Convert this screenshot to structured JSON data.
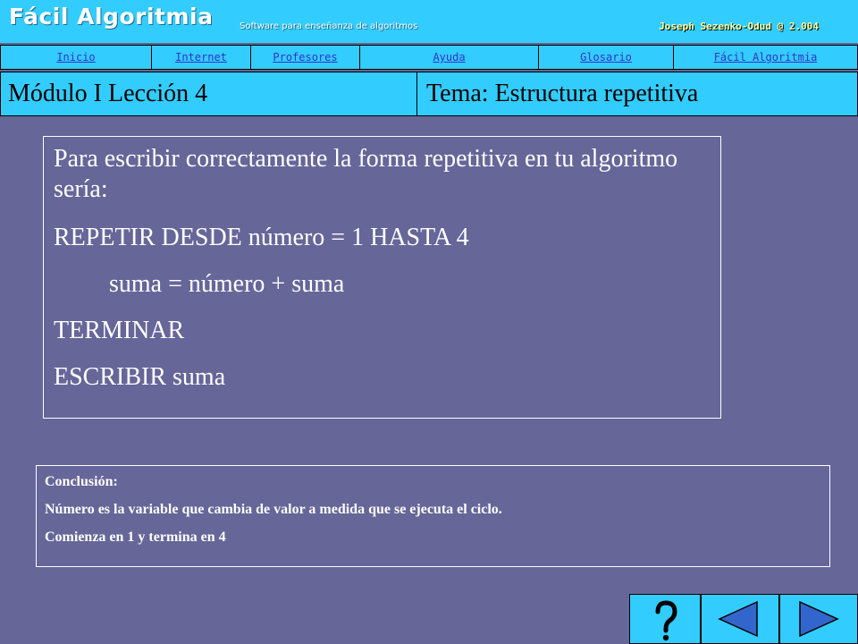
{
  "header": {
    "app_title": "Fácil Algoritmia",
    "subtitle": "Software para enseñanza de algoritmos",
    "author": "Joseph Sezenko-Odud @ 2.004"
  },
  "nav": [
    {
      "label": "Inicio"
    },
    {
      "label": "Internet"
    },
    {
      "label": "Profesores"
    },
    {
      "label": "Ayuda"
    },
    {
      "label": "Glosario"
    },
    {
      "label": "Fácil Algoritmia"
    }
  ],
  "module": {
    "left": "Módulo I  Lección 4",
    "right": "Tema: Estructura repetitiva"
  },
  "content": {
    "lines": [
      "Para escribir correctamente la forma repetitiva en tu algoritmo sería:",
      "REPETIR DESDE número = 1 HASTA  4",
      "suma = número + suma",
      "TERMINAR",
      "ESCRIBIR suma"
    ]
  },
  "conclusion": {
    "lines": [
      "Conclusión:",
      "Número es la variable que cambia de valor a medida que se ejecuta el ciclo.",
      "Comienza en 1 y termina en 4"
    ]
  },
  "footer_buttons": [
    {
      "icon": "question-mark-icon"
    },
    {
      "icon": "triangle-left-icon"
    },
    {
      "icon": "triangle-right-icon"
    }
  ],
  "colors": {
    "background": "#666699",
    "banner": "#33CCFF",
    "nav_link": "#3333cc",
    "author_text": "#ffff99",
    "arrow_fill": "#3366cc"
  }
}
